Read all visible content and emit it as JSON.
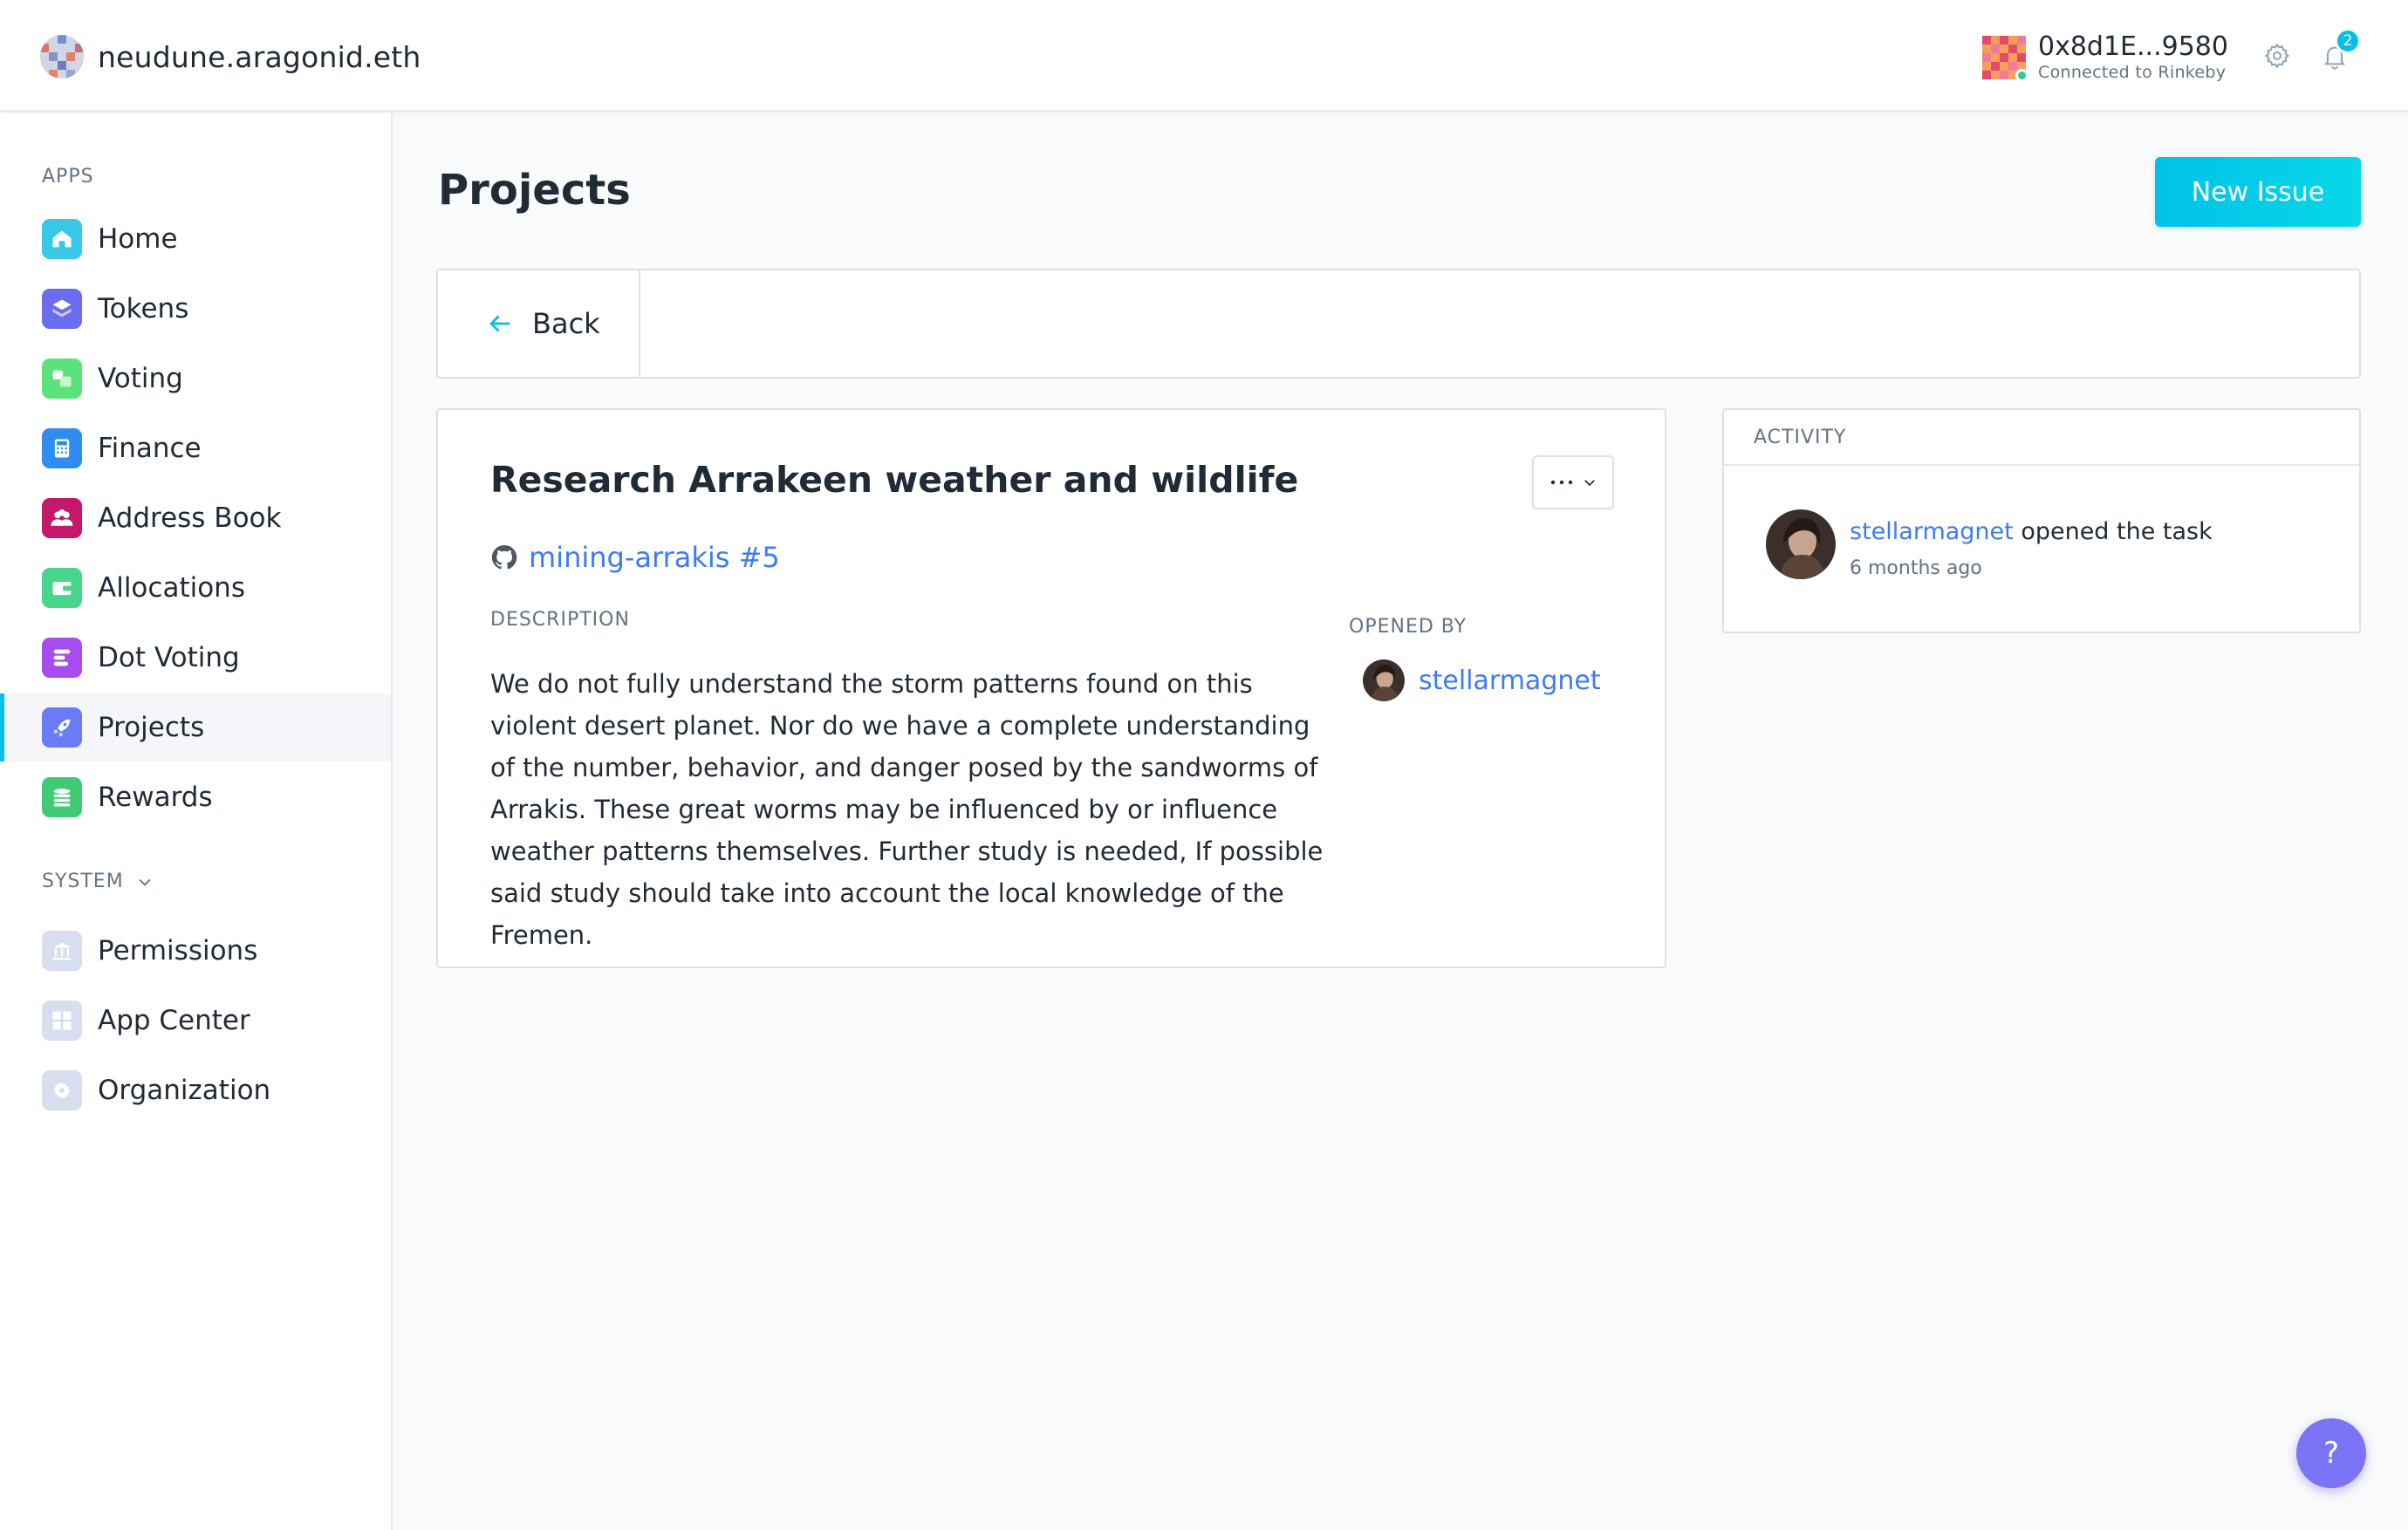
{
  "header": {
    "org_name": "neudune.aragonid.eth",
    "account_address": "0x8d1E...9580",
    "network_status": "Connected to Rinkeby",
    "notification_count": "2",
    "accent_color": "#08bee5"
  },
  "sidebar": {
    "apps_label": "APPS",
    "system_label": "SYSTEM",
    "apps": [
      {
        "label": "Home",
        "icon": "home-icon",
        "color": "#38c9e8"
      },
      {
        "label": "Tokens",
        "icon": "tokens-icon",
        "color": "#6c6cf0"
      },
      {
        "label": "Voting",
        "icon": "voting-icon",
        "color": "#5ce27a"
      },
      {
        "label": "Finance",
        "icon": "finance-icon",
        "color": "#2f8cf0"
      },
      {
        "label": "Address Book",
        "icon": "address-book-icon",
        "color": "#c4196b"
      },
      {
        "label": "Allocations",
        "icon": "allocations-icon",
        "color": "#47d68c"
      },
      {
        "label": "Dot Voting",
        "icon": "dot-voting-icon",
        "color": "#a64cf0"
      },
      {
        "label": "Projects",
        "icon": "projects-icon",
        "color": "#6a7cf5"
      },
      {
        "label": "Rewards",
        "icon": "rewards-icon",
        "color": "#3ecb73"
      }
    ],
    "system": [
      {
        "label": "Permissions",
        "icon": "permissions-icon"
      },
      {
        "label": "App Center",
        "icon": "app-center-icon"
      },
      {
        "label": "Organization",
        "icon": "organization-icon"
      }
    ],
    "active_item": "Projects"
  },
  "main": {
    "title": "Projects",
    "new_issue_label": "New Issue",
    "back_label": "Back"
  },
  "issue": {
    "title": "Research Arrakeen weather and wildlife",
    "repo_link": "mining-arrakis #5",
    "description_label": "DESCRIPTION",
    "description": "We do not fully understand the storm patterns found on this violent desert planet. Nor do we have a complete understanding of the number, behavior, and danger posed by the sandworms of Arrakis. These great worms may be influenced by or influence weather patterns themselves. Further study is needed, If possible said study should take into account the local knowledge of the Fremen.",
    "opened_by_label": "OPENED BY",
    "opened_by": "stellarmagnet"
  },
  "activity": {
    "header": "ACTIVITY",
    "entries": [
      {
        "user": "stellarmagnet",
        "action": " opened the task",
        "time": "6 months ago"
      }
    ]
  },
  "help": {
    "label": "?"
  }
}
